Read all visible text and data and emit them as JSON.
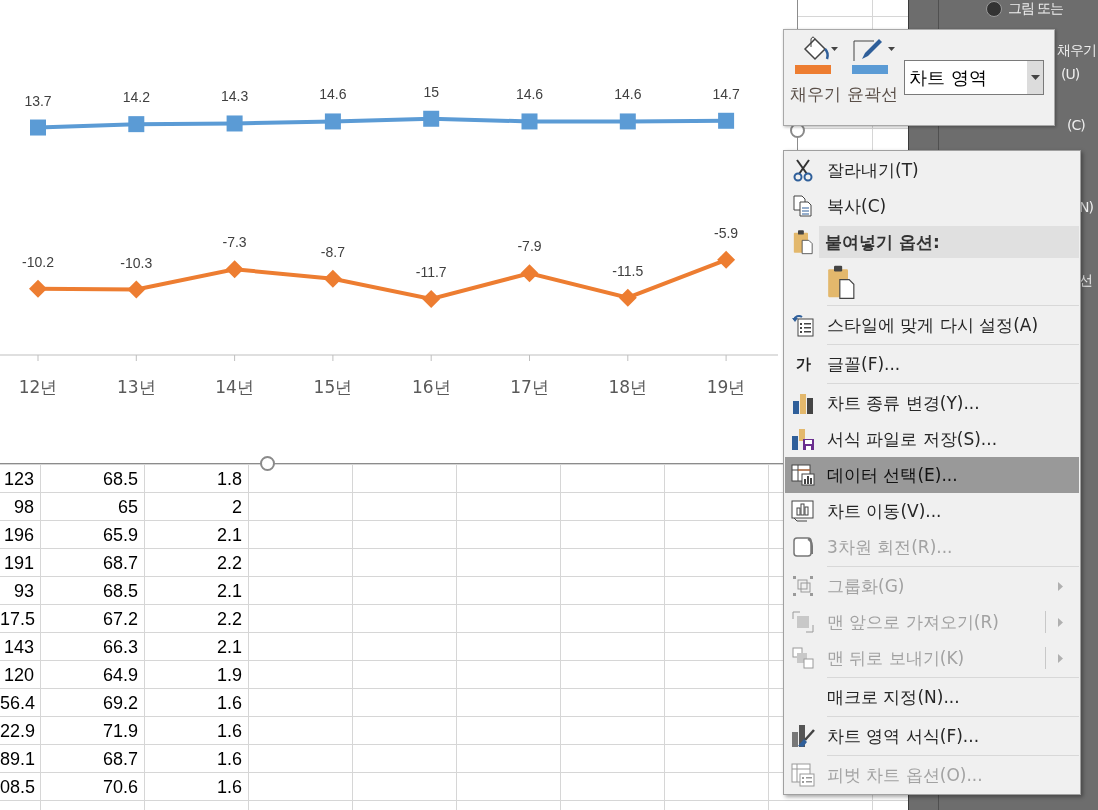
{
  "format_pane": {
    "radio_label": "그림 또는",
    "radio_selected": true,
    "fragments": [
      "채우기",
      "(U)",
      "(C)",
      "N)",
      "선"
    ]
  },
  "chart": {
    "chart_data": {
      "type": "line",
      "categories": [
        "12년",
        "13년",
        "14년",
        "15년",
        "16년",
        "17년",
        "18년",
        "19년"
      ],
      "series": [
        {
          "color": "#5b9bd5",
          "marker": "square",
          "values": [
            13.7,
            14.2,
            14.3,
            14.6,
            15,
            14.6,
            14.6,
            14.7
          ]
        },
        {
          "color": "#ed7d31",
          "marker": "diamond",
          "values": [
            -10.2,
            -10.3,
            -7.3,
            -8.7,
            -11.7,
            -7.9,
            -11.5,
            -5.9
          ]
        }
      ],
      "data_labels": true
    }
  },
  "table": {
    "rows": [
      {
        "cells": [
          "123",
          "68.5",
          "1.8"
        ]
      },
      {
        "cells": [
          "98",
          "65",
          "2"
        ]
      },
      {
        "cells": [
          "196",
          "65.9",
          "2.1"
        ]
      },
      {
        "cells": [
          "191",
          "68.7",
          "2.2"
        ]
      },
      {
        "cells": [
          "93",
          "68.5",
          "2.1"
        ]
      },
      {
        "cells": [
          "17.5",
          "67.2",
          "2.2"
        ]
      },
      {
        "cells": [
          "143",
          "66.3",
          "2.1"
        ]
      },
      {
        "cells": [
          "120",
          "64.9",
          "1.9"
        ]
      },
      {
        "cells": [
          "56.4",
          "69.2",
          "1.6"
        ]
      },
      {
        "cells": [
          "22.9",
          "71.9",
          "1.6"
        ]
      },
      {
        "cells": [
          "89.1",
          "68.7",
          "1.6"
        ]
      },
      {
        "cells": [
          "08.5",
          "70.6",
          "1.6"
        ]
      }
    ]
  },
  "mini_toolbar": {
    "buttons": [
      {
        "label": "채우기",
        "color": "#ed7d31"
      },
      {
        "label": "윤곽선",
        "color": "#5b9bd5"
      }
    ],
    "element_select": {
      "value": "차트 영역"
    }
  },
  "context_menu": {
    "items": [
      {
        "kind": "command",
        "label": "잘라내기(T)",
        "disabled": false,
        "highlighted": false,
        "submenu": false,
        "split": false
      },
      {
        "kind": "command",
        "label": "복사(C)",
        "disabled": false,
        "highlighted": false,
        "submenu": false,
        "split": false
      },
      {
        "kind": "header",
        "label": "붙여넣기 옵션:"
      },
      {
        "kind": "paste"
      },
      {
        "kind": "separator"
      },
      {
        "kind": "command",
        "label": "스타일에 맞게 다시 설정(A)",
        "disabled": false,
        "highlighted": false,
        "submenu": false,
        "split": false
      },
      {
        "kind": "separator"
      },
      {
        "kind": "command",
        "icon_text": "가",
        "label": "글꼴(F)...",
        "disabled": false,
        "highlighted": false,
        "submenu": false,
        "split": false
      },
      {
        "kind": "separator"
      },
      {
        "kind": "command",
        "label": "차트 종류 변경(Y)...",
        "disabled": false,
        "highlighted": false,
        "submenu": false,
        "split": false
      },
      {
        "kind": "command",
        "label": "서식 파일로 저장(S)...",
        "disabled": false,
        "highlighted": false,
        "submenu": false,
        "split": false
      },
      {
        "kind": "command",
        "label": "데이터 선택(E)...",
        "disabled": false,
        "highlighted": true,
        "submenu": false,
        "split": false
      },
      {
        "kind": "command",
        "label": "차트 이동(V)...",
        "disabled": false,
        "highlighted": false,
        "submenu": false,
        "split": false
      },
      {
        "kind": "command",
        "label": "3차원 회전(R)...",
        "disabled": true,
        "highlighted": false,
        "submenu": false,
        "split": false
      },
      {
        "kind": "separator"
      },
      {
        "kind": "command",
        "label": "그룹화(G)",
        "disabled": true,
        "highlighted": false,
        "submenu": true,
        "split": false
      },
      {
        "kind": "command",
        "label": "맨 앞으로 가져오기(R)",
        "disabled": true,
        "highlighted": false,
        "submenu": true,
        "split": true
      },
      {
        "kind": "command",
        "label": "맨 뒤로 보내기(K)",
        "disabled": true,
        "highlighted": false,
        "submenu": true,
        "split": true
      },
      {
        "kind": "separator"
      },
      {
        "kind": "command",
        "label": "매크로 지정(N)...",
        "disabled": false,
        "highlighted": false,
        "submenu": false,
        "split": false
      },
      {
        "kind": "separator"
      },
      {
        "kind": "command",
        "label": "차트 영역 서식(F)...",
        "disabled": false,
        "highlighted": false,
        "submenu": false,
        "split": false
      },
      {
        "kind": "separator"
      },
      {
        "kind": "command",
        "label": "피벗 차트 옵션(O)...",
        "disabled": true,
        "highlighted": false,
        "submenu": false,
        "split": false
      }
    ]
  }
}
